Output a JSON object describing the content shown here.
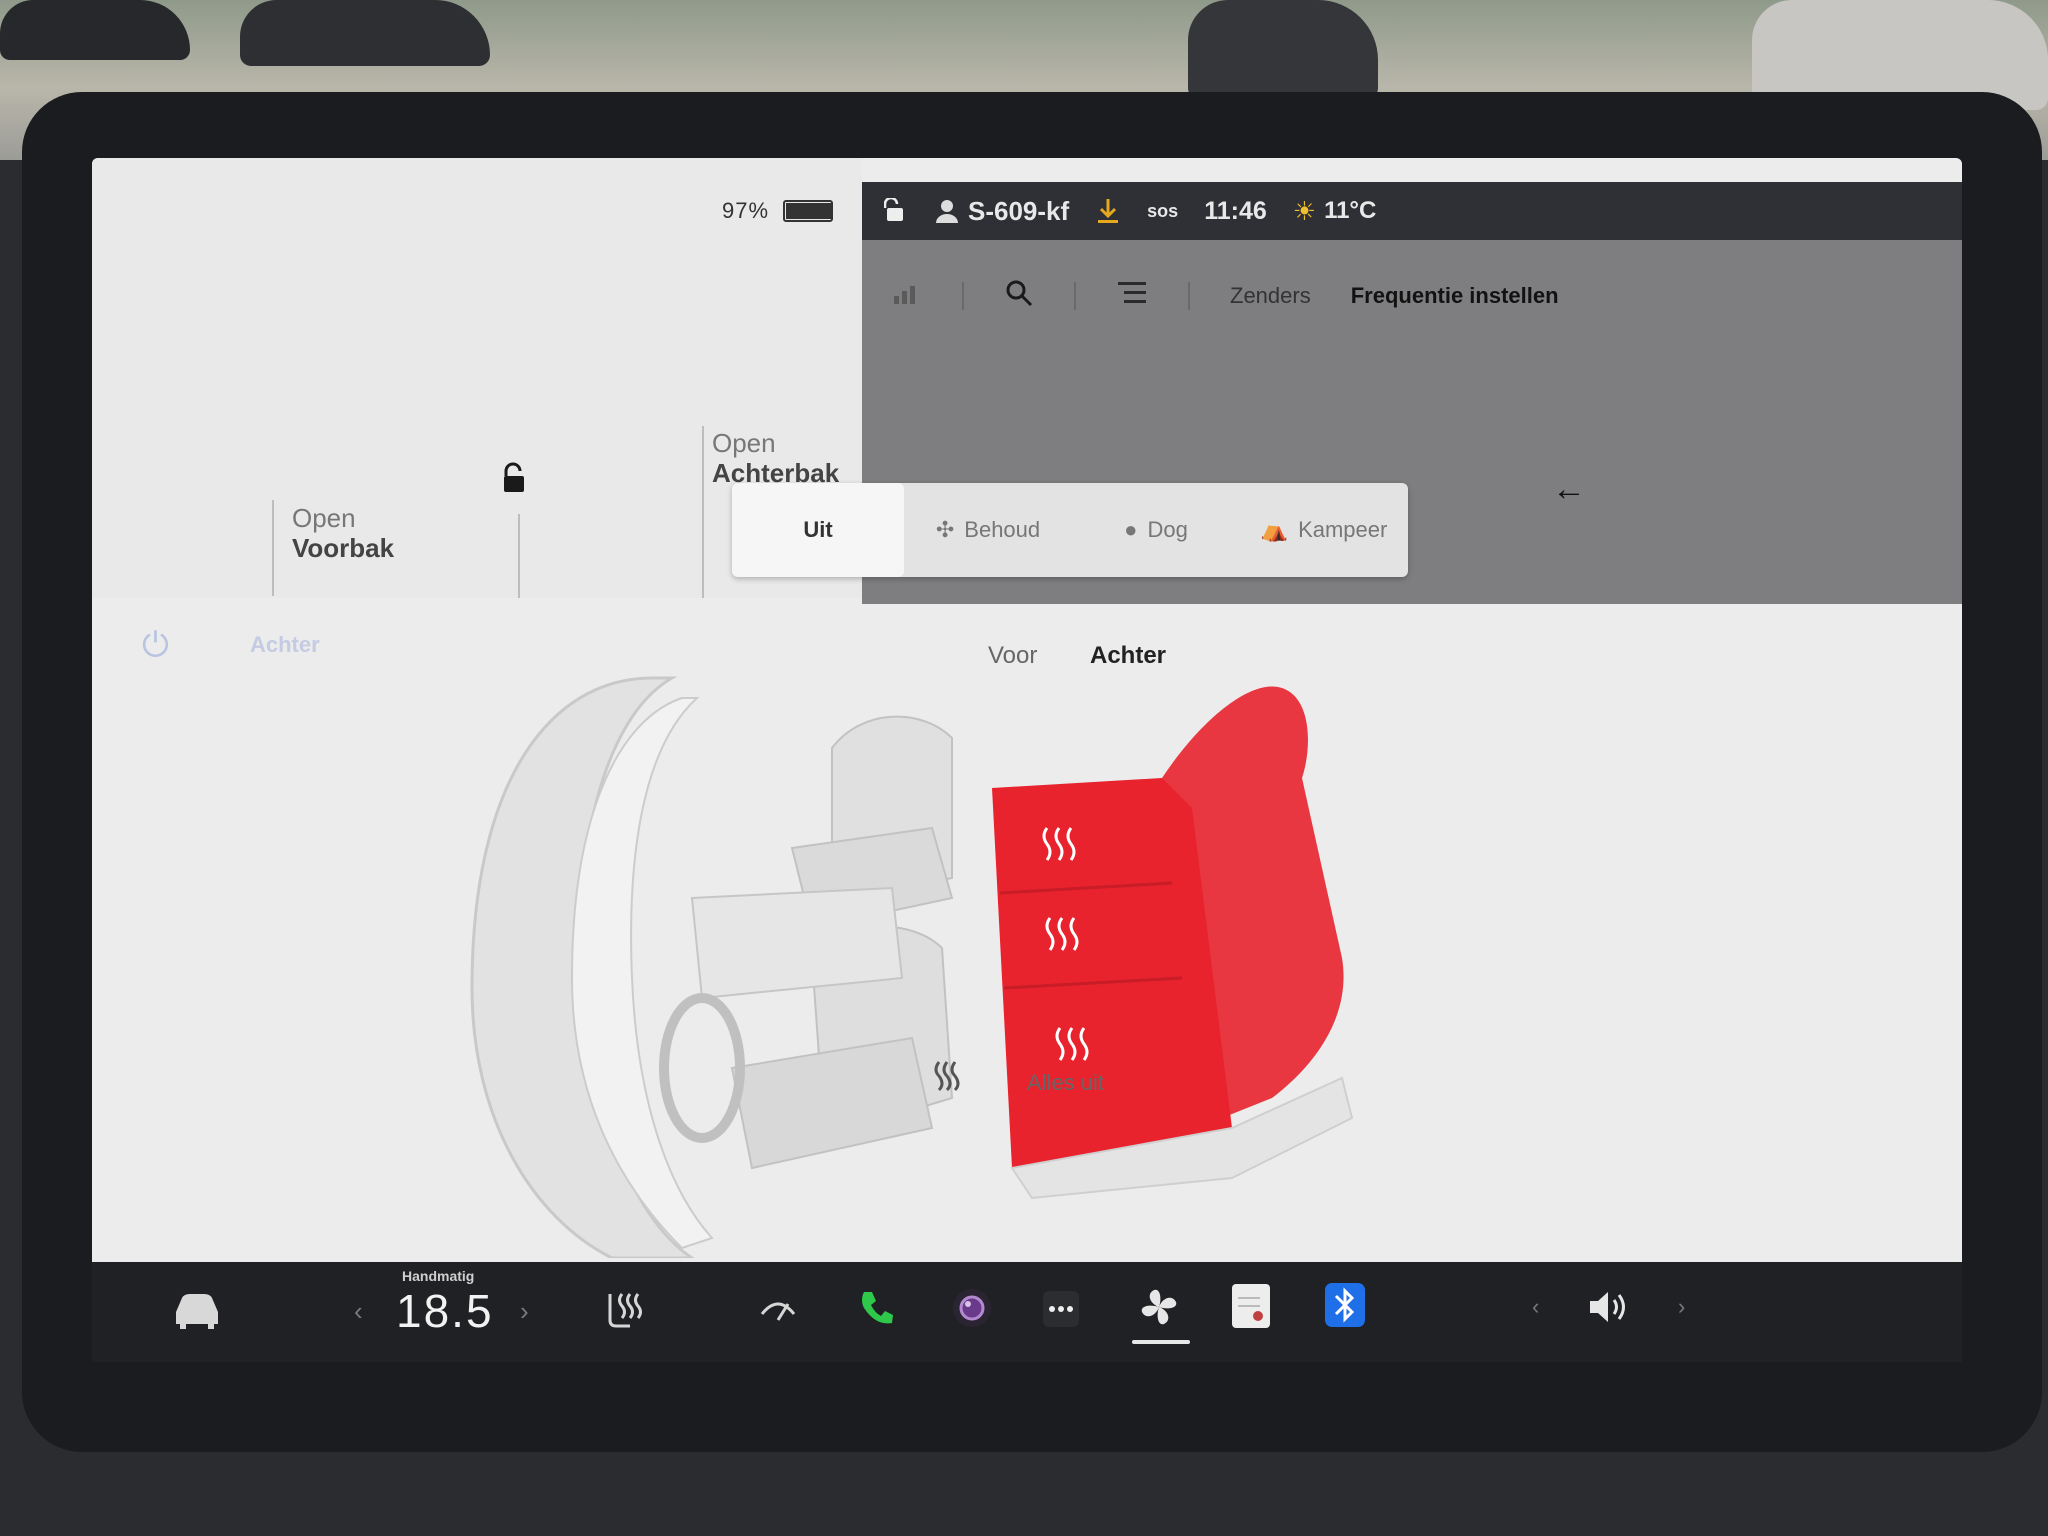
{
  "battery": {
    "percent": "97%",
    "level": 0.97
  },
  "statusbar": {
    "profile": "S-609-kf",
    "sos": "sos",
    "time": "11:46",
    "temperature": "11°C"
  },
  "car": {
    "frunk": {
      "line1": "Open",
      "line2": "Voorbak"
    },
    "trunk": {
      "line1": "Open",
      "line2": "Achterbak"
    }
  },
  "media": {
    "tab_zenders": "Zenders",
    "tab_frequency": "Frequentie instellen",
    "icons": [
      "signal-icon",
      "search-icon",
      "list-icon"
    ]
  },
  "modes": [
    {
      "label": "Uit",
      "icon": "",
      "active": true
    },
    {
      "label": "Behoud",
      "icon": "fan-icon",
      "active": false
    },
    {
      "label": "Dog",
      "icon": "paw-icon",
      "active": false
    },
    {
      "label": "Kampeer",
      "icon": "tent-icon",
      "active": false
    }
  ],
  "climate": {
    "rear_label_faint": "Achter",
    "segment_front": "Voor",
    "segment_rear": "Achter",
    "all_off": "Alles uit",
    "rear_seat_heat_levels": [
      3,
      3,
      3
    ]
  },
  "bottombar": {
    "mode": "Handmatig",
    "temp": "18.5",
    "icons": [
      "car-icon",
      "seat-heat-icon",
      "wiper-icon",
      "phone-icon",
      "camera-icon",
      "more-icon",
      "fan-icon",
      "notes-icon",
      "bluetooth-icon",
      "volume-icon"
    ]
  },
  "colors": {
    "seat_heat": "#e8232e",
    "phone": "#2ec84a",
    "bluetooth": "#1e6fe8",
    "charging": "#e6a81e"
  }
}
